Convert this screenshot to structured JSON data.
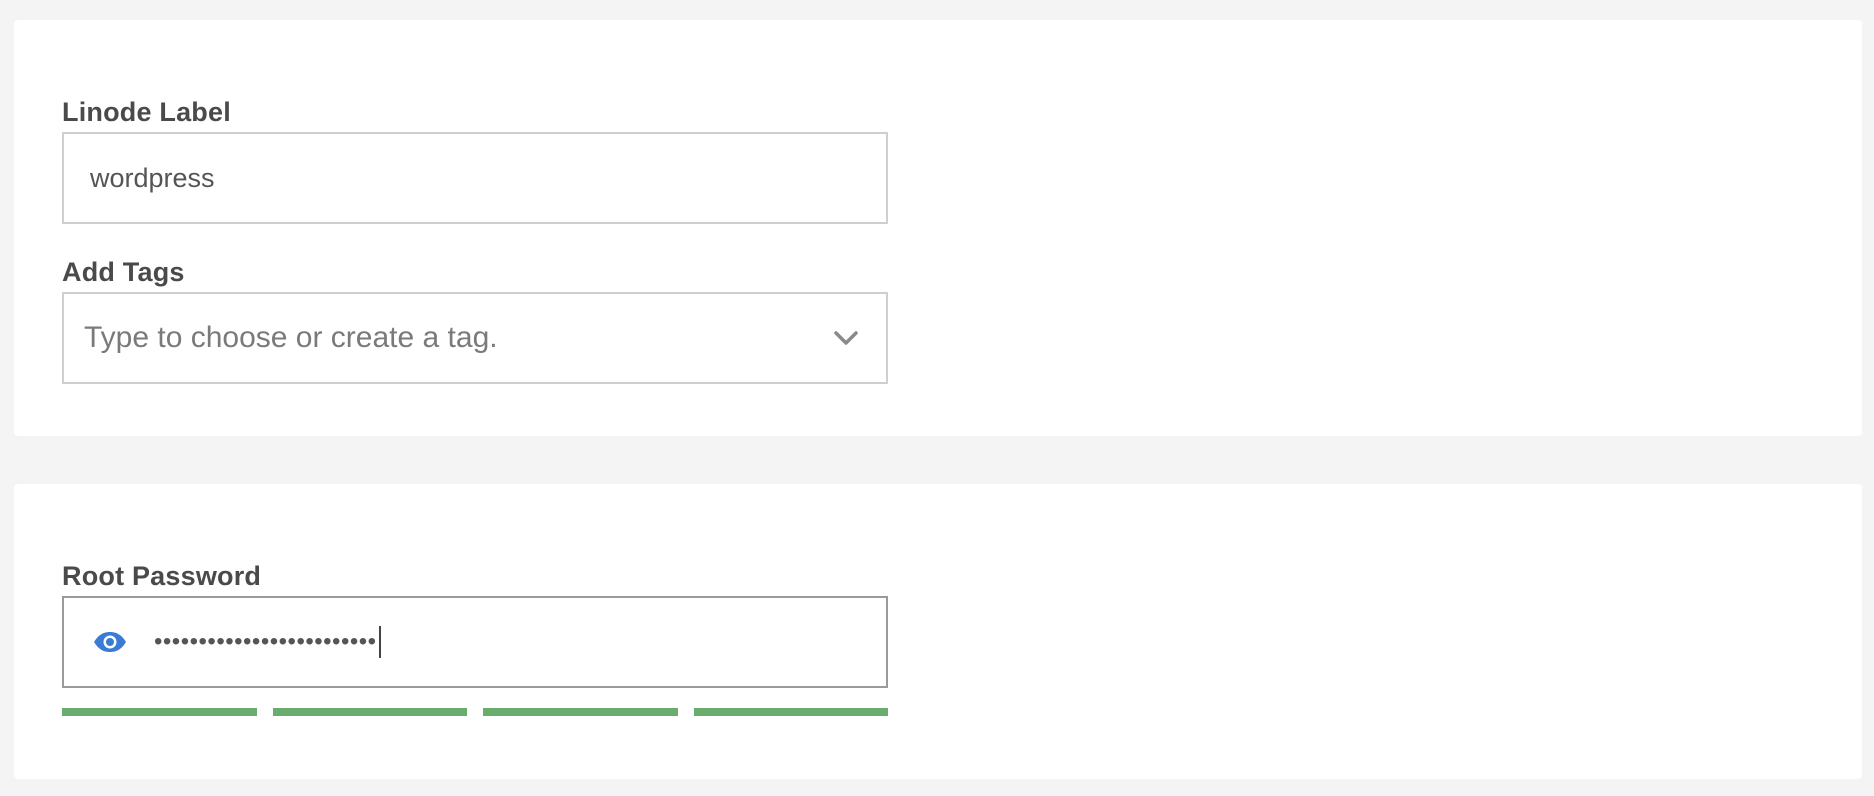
{
  "details": {
    "label_title": "Linode Label",
    "label_value": "wordpress",
    "tags_title": "Add Tags",
    "tags_placeholder": "Type to choose or create a tag."
  },
  "password": {
    "title": "Root Password",
    "masked_value": "•••••••••••••••••••••••••",
    "toggle_icon": "eye-icon",
    "strength": {
      "filled_segments": 4,
      "total_segments": 4,
      "color": "#6aab6e"
    }
  },
  "colors": {
    "page_background": "#f4f4f4",
    "card_background": "#ffffff",
    "eye_icon": "#3a7bd5",
    "strength_bar": "#6aab6e"
  }
}
